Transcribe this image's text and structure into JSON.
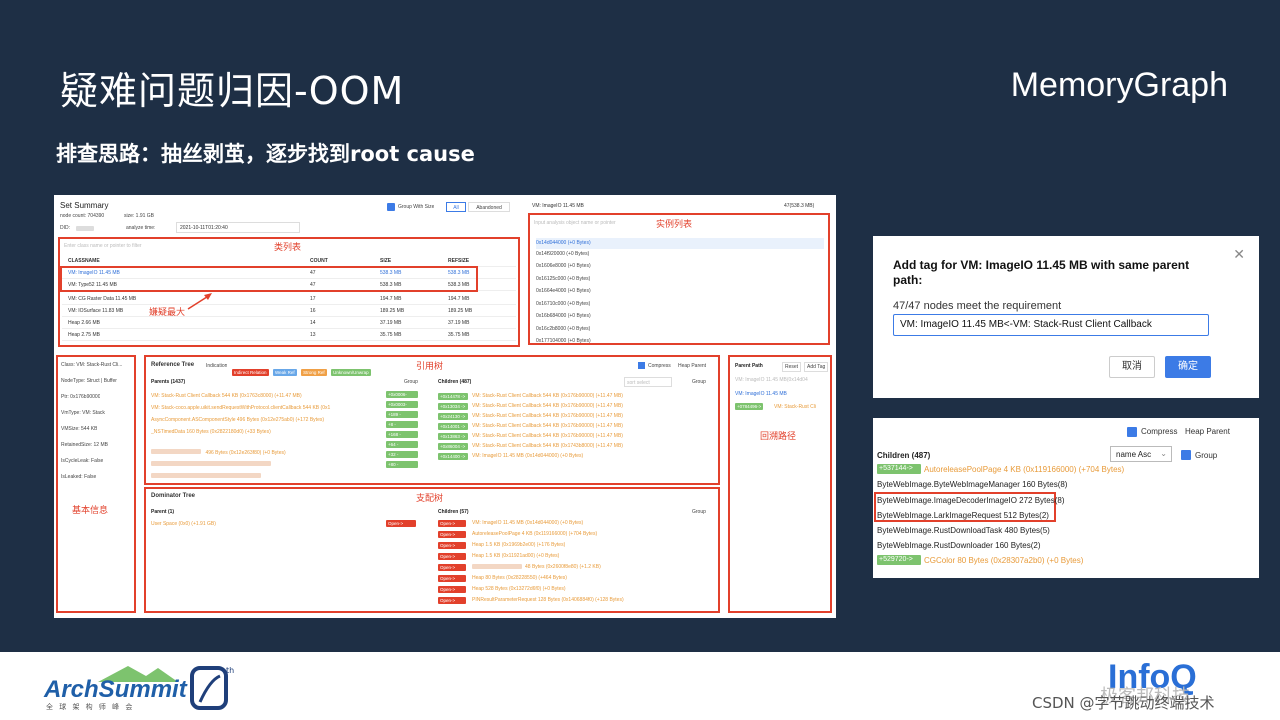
{
  "slide": {
    "title": "疑难问题归因-OOM",
    "brand": "MemoryGraph",
    "subtitle": "排查思路：抽丝剥茧，逐步找到root cause"
  },
  "set_summary": {
    "title": "Set Summary",
    "node_count": "node count: 704390",
    "size": "size: 1.91 GB",
    "did_label": "DID:",
    "analyze_time_label": "analyze time:",
    "analyze_time": "2021-10-11T01:20:40",
    "group_with_size": "Group With Size",
    "tab_all": "All",
    "tab_abandoned": "Abandoned",
    "filter_placeholder": "Enter class name or pointer to filter",
    "headers": [
      "CLASSNAME",
      "COUNT",
      "SIZE",
      "REFSIZE"
    ],
    "rows": [
      [
        "VM: ImageIO 11.45 MB",
        "47",
        "538.3 MB",
        "538.3 MB"
      ],
      [
        "VM: Type52 11.45 MB",
        "47",
        "538.3 MB",
        "538.3 MB"
      ],
      [
        "VM: CG Raster Data 11.45 MB",
        "17",
        "194.7 MB",
        "194.7 MB"
      ],
      [
        "VM: IOSurface 11.83 MB",
        "16",
        "189.25 MB",
        "189.25 MB"
      ],
      [
        "Heap 2.66 MB",
        "14",
        "37.19 MB",
        "37.19 MB"
      ],
      [
        "Heap 2.75 MB",
        "13",
        "35.75 MB",
        "35.75 MB"
      ]
    ]
  },
  "instances": {
    "header": "VM: ImageIO 11.45 MB",
    "count": "47(538.3 MB)",
    "search_placeholder": "Input analysis object name or pointer",
    "items": [
      "0x14d044000 (+0 Bytes)",
      "0x14f920000 (+0 Bytes)",
      "0x1606e8000 (+0 Bytes)",
      "0x16125c000 (+0 Bytes)",
      "0x1664e4000 (+0 Bytes)",
      "0x16710c000 (+0 Bytes)",
      "0x16b684000 (+0 Bytes)",
      "0x16c2b8000 (+0 Bytes)",
      "0x177104000 (+0 Bytes)"
    ]
  },
  "basic_info": {
    "items": [
      "Class: VM: Stack-Rust Cli...",
      "NodeType: Struct | Buffer",
      "Ptr: 0x176b90000",
      "VmType: VM: Stack",
      "VMSize: 544 KB",
      "RetainedSize: 12 MB",
      "IsCycleLeak: False",
      "IsLeaked: False"
    ]
  },
  "reference_tree": {
    "title": "Reference Tree",
    "indication": "Indication",
    "tags": [
      "Indirect Relation",
      "Weak Ref",
      "Strong Ref",
      "Unknown/Unwrap"
    ],
    "compress": "Compress",
    "heap_parent": "Heap Parent",
    "parents_label": "Parents (1437)",
    "group": "Group",
    "children_label": "Children (487)",
    "sort_select": "sort select",
    "parents": [
      "VM: Stack-Rust Client Callback 544 KB (0x1763c8000) (+11.47 MB)",
      "VM: Stack-coco.apple.uikit.sendRequestWithProtocol.clientCallback 544 KB (0x1",
      "AsyncComponent.ASComponentStyle 496 Bytes (0x12e275ab0) (+172 Bytes)",
      "_NSTimedData 160 Bytes (0x2822180d0) (+33 Bytes)",
      "496 Bytes (0x12e263f80) (+0 Bytes)"
    ],
    "parent_buttons": [
      "+0x0006-",
      "+0x0003-",
      "+189 -",
      "+8 -",
      "+168 -",
      "+64 -",
      "+32 -",
      "+80 -"
    ],
    "child_buttons": [
      "+0x14478 ->",
      "+0x13034 ->",
      "+0x24130 ->",
      "+0x14001 ->",
      "+0x13863 ->",
      "+0x86004 ->",
      "+0x14400 ->"
    ],
    "children": [
      "VM: Stack-Rust Client Callback 544 KB (0x176b90000) (+11.47 MB)",
      "VM: Stack-Rust Client Callback 544 KB (0x176b90000) (+11.47 MB)",
      "VM: Stack-Rust Client Callback 544 KB (0x176b90000) (+11.47 MB)",
      "VM: Stack-Rust Client Callback 544 KB (0x176b90000) (+11.47 MB)",
      "VM: Stack-Rust Client Callback 544 KB (0x176b90000) (+11.47 MB)",
      "VM: Stack-Rust Client Callback 544 KB (0x1743b8000) (+11.47 MB)",
      "VM: ImageIO 11.45 MB (0x14d044000) (+0 Bytes)"
    ]
  },
  "dominator_tree": {
    "title": "Dominator Tree",
    "parent_label": "Parent (1)",
    "parent_item": "User Space (0x0) (+1.91 GB)",
    "open_label": "Open->",
    "children_label": "Children (57)",
    "group": "Group",
    "children": [
      "VM: ImageIO 11.45 MB (0x14d044000) (+0 Bytes)",
      "AutoreleasePoolPage 4 KB (0x119166000) (+704 Bytes)",
      "Heap 1.5 KB (0x1969b2e00) (+176 Bytes)",
      "Heap 1.5 KB (0x11921ad00) (+0 Bytes)",
      "48 Bytes (0x2600f8e80) (+1.2 KB)",
      "Heap 80 Bytes (0x28228550) (+464 Bytes)",
      "Heap 528 Bytes (0x13272d6f0) (+0 Bytes)",
      "PINResultParameterRequest 128 Bytes (0x1406884f0) (+128 Bytes)"
    ]
  },
  "parent_path": {
    "title": "Parent Path",
    "reset": "Reset",
    "add_tag": "Add Tag",
    "top": "VM: ImageIO 11.45 MB(0x14d04",
    "item1": "VM: ImageIO 11.45 MB",
    "item2_btn": "+0784496->",
    "item2": "VM: Stack-Rust Cli"
  },
  "annotations": {
    "class_list": "类列表",
    "instance_list": "实例列表",
    "most_suspect": "嫌疑最大",
    "basic_info": "基本信息",
    "ref_tree": "引用树",
    "backtrack": "回溯路径",
    "dominator": "支配树"
  },
  "dialog": {
    "title": "Add tag for VM: ImageIO 11.45 MB with same parent path:",
    "info": "47/47 nodes meet the requirement",
    "input_value": "VM: ImageIO 11.45 MB<-VM: Stack-Rust Client Callback",
    "cancel": "取消",
    "confirm": "确定"
  },
  "children_panel": {
    "compress": "Compress",
    "heap_parent": "Heap Parent",
    "title": "Children (487)",
    "sort": "name Asc",
    "group": "Group",
    "rows": [
      {
        "btn": "+537144->",
        "text": "AutoreleasePoolPage 4 KB (0x119166000) (+704 Bytes)"
      },
      {
        "btn": "",
        "text": "ByteWebImage.ByteWebImageManager 160 Bytes(8)"
      },
      {
        "btn": "",
        "text": "ByteWebImage.ImageDecoderImageIO 272 Bytes(8)"
      },
      {
        "btn": "",
        "text": "ByteWebImage.LarkImageRequest 512 Bytes(2)"
      },
      {
        "btn": "",
        "text": "ByteWebImage.RustDownloadTask 480 Bytes(5)"
      },
      {
        "btn": "",
        "text": "ByteWebImage.RustDownloader 160 Bytes(2)"
      },
      {
        "btn": "+529720->",
        "text": "CGColor 80 Bytes (0x28307a2b0) (+0 Bytes)"
      }
    ]
  },
  "footer": {
    "logo": "ArchSummit",
    "logo_sub": "全 球 架 构 师 峰 会",
    "th": "th",
    "infoq": "InfoQ",
    "infoq_cn": "极客邦科技",
    "watermark": "CSDN @字节跳动终端技术"
  },
  "colors": {
    "background": "#1e2f45",
    "accent_red": "#e2402b",
    "green": "#7dc36e",
    "blue": "#2f6fd8",
    "orange": "#e89b3a"
  }
}
